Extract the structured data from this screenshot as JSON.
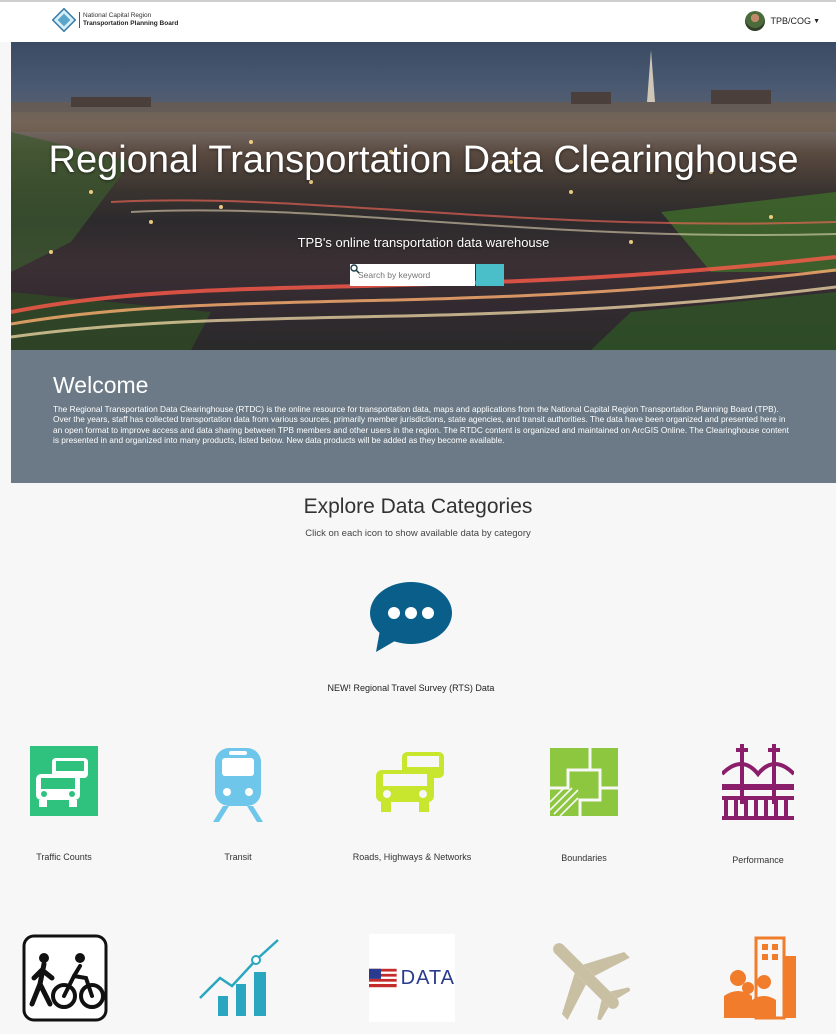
{
  "header": {
    "logo_line1": "National Capital Region",
    "logo_line2": "Transportation Planning Board",
    "user_label": "TPB/COG"
  },
  "hero": {
    "title": "Regional Transportation Data Clearinghouse",
    "subtitle": "TPB's online transportation data warehouse",
    "search_placeholder": "Search by keyword"
  },
  "welcome": {
    "heading": "Welcome",
    "body": "The Regional Transportation Data Clearinghouse (RTDC) is the online resource for transportation data, maps and applications from the National Capital Region Transportation Planning Board (TPB). Over the years, staff has collected transportation data from various sources, primarily member jurisdictions, state agencies, and transit authorities. The data have been organized and presented here in an open format to improve access and data sharing between TPB members and other users in the region. The RTDC content is organized and maintained on ArcGIS Online. The Clearinghouse content is presented in and organized into many products, listed below. New data products will be added as they become available."
  },
  "explore": {
    "title": "Explore Data Categories",
    "subtitle": "Click on each icon to show available data by category",
    "featured_label": "NEW! Regional Travel Survey (RTS) Data"
  },
  "categories": [
    {
      "label": "Traffic Counts",
      "icon": "traffic-counts-icon",
      "color": "#2ec27e"
    },
    {
      "label": "Transit",
      "icon": "transit-icon",
      "color": "#6ec6ea"
    },
    {
      "label": "Roads, Highways & Networks",
      "icon": "roads-icon",
      "color": "#c8e62e"
    },
    {
      "label": "Boundaries",
      "icon": "boundaries-icon",
      "color": "#8dc63f"
    },
    {
      "label": "Performance",
      "icon": "performance-icon",
      "color": "#8b1e6b"
    }
  ],
  "categories_row2": [
    {
      "icon": "bike-ped-icon",
      "color": "#111111"
    },
    {
      "icon": "growth-chart-icon",
      "color": "#2aa6c0"
    },
    {
      "icon": "census-data-icon",
      "text": "DATA",
      "color": "#2a3b8f"
    },
    {
      "icon": "airplane-icon",
      "color": "#c9c0a4"
    },
    {
      "icon": "demographics-icon",
      "color": "#f07c2c"
    }
  ],
  "colors": {
    "accent": "#4bbfc9",
    "welcome_bg": "#6b7a86",
    "rts_blue": "#0a5f8a"
  }
}
